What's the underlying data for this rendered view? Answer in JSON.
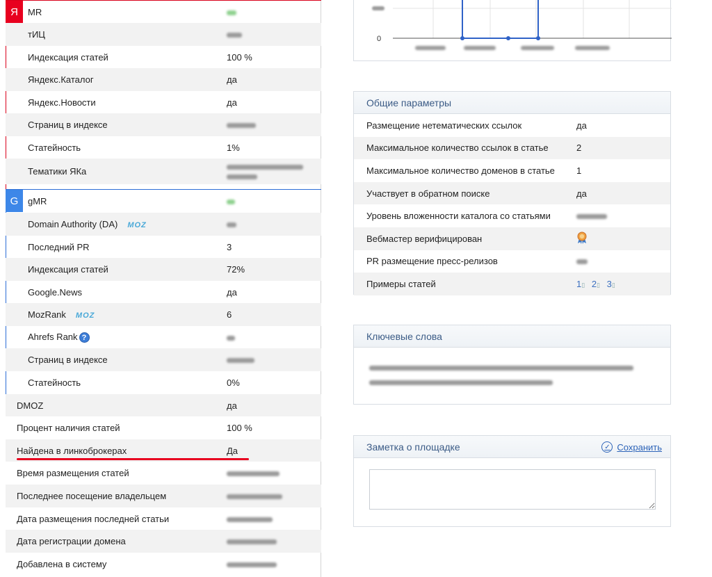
{
  "yandex": {
    "badge": "Я",
    "rows": [
      {
        "label": "MR",
        "value": ""
      },
      {
        "label": "тИЦ",
        "value": ""
      },
      {
        "label": "Индексация статей",
        "value": "100 %"
      },
      {
        "label": "Яндекс.Каталог",
        "value": "да"
      },
      {
        "label": "Яндекс.Новости",
        "value": "да"
      },
      {
        "label": "Страниц в индексе",
        "value": ""
      },
      {
        "label": "Статейность",
        "value": "1%"
      },
      {
        "label": "Тематики ЯКа",
        "value": ""
      }
    ]
  },
  "google": {
    "badge": "G",
    "moz_logo": "MOZ",
    "help_icon": "?",
    "rows": [
      {
        "label": "gMR",
        "value": ""
      },
      {
        "label": "Domain Authority (DA)",
        "value": ""
      },
      {
        "label": "Последний PR",
        "value": "3"
      },
      {
        "label": "Индексация статей",
        "value": "72%"
      },
      {
        "label": "Google.News",
        "value": "да"
      },
      {
        "label": "MozRank",
        "value": "6"
      },
      {
        "label": "Ahrefs Rank",
        "value": ""
      },
      {
        "label": "Страниц в индексе",
        "value": ""
      },
      {
        "label": "Статейность",
        "value": "0%"
      }
    ]
  },
  "general": {
    "rows": [
      {
        "label": "DMOZ",
        "value": "да"
      },
      {
        "label": "Процент наличия статей",
        "value": "100 %"
      },
      {
        "label": "Найдена в линкоброкерах",
        "value": "Да"
      },
      {
        "label": "Время размещения статей",
        "value": ""
      },
      {
        "label": "Последнее посещение владельцем",
        "value": ""
      },
      {
        "label": "Дата размещения последней статьи",
        "value": ""
      },
      {
        "label": "Дата регистрации домена",
        "value": ""
      },
      {
        "label": "Добавлена в систему",
        "value": ""
      }
    ]
  },
  "chart": {
    "tick_top": "",
    "tick_zero": "0"
  },
  "params": {
    "title": "Общие параметры",
    "rows": [
      {
        "label": "Размещение нетематических ссылок",
        "value": "да"
      },
      {
        "label": "Максимальное количество ссылок в статье",
        "value": "2"
      },
      {
        "label": "Максимальное количество доменов в статье",
        "value": "1"
      },
      {
        "label": "Участвует в обратном поиске",
        "value": "да"
      },
      {
        "label": "Уровень вложенности каталога со статьями",
        "value": ""
      },
      {
        "label": "Вебмастер верифицирован",
        "value": ""
      },
      {
        "label": "PR размещение пресс-релизов",
        "value": ""
      },
      {
        "label": "Примеры статей",
        "value": ""
      }
    ],
    "example_links": [
      "1",
      "2",
      "3"
    ]
  },
  "keywords": {
    "title": "Ключевые слова"
  },
  "note": {
    "title": "Заметка о площадке",
    "save_label": "Сохранить",
    "text": ""
  },
  "colors": {
    "yandex_red": "#e8001f",
    "google_blue": "#3d87e8",
    "link_blue": "#2c63b8",
    "panel_title": "#3b5b86"
  }
}
